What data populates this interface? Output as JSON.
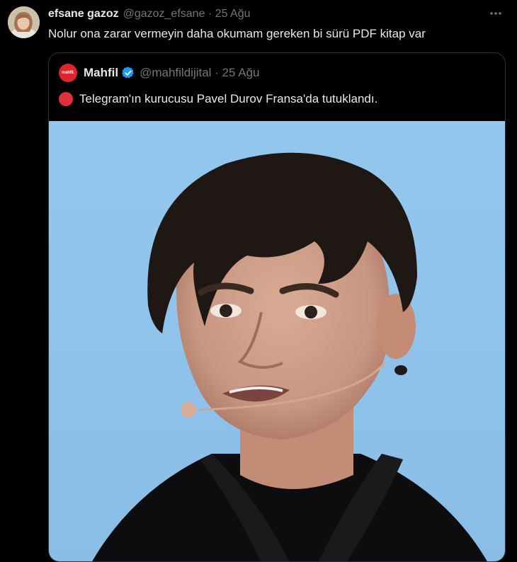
{
  "tweet": {
    "author_name": "efsane gazoz",
    "handle_date": "@gazoz_efsane · 25 Ağu",
    "text": "Nolur ona zarar vermeyin daha okumam gereken bi sürü PDF kitap var",
    "more_icon": "more-horizontal-icon"
  },
  "quoted": {
    "author_name": "Mahfil",
    "avatar_text": "mahfil.",
    "verified_icon": "verified-badge-icon",
    "handle_date": "@mahfildijital · 25 Ağu",
    "text": "Telegram'ın kurucusu Pavel Durov Fransa'da tutuklandı.",
    "emoji": "red-circle-icon"
  },
  "colors": {
    "background": "#000000",
    "text": "#e7e9ea",
    "muted": "#71767b",
    "border": "#2f3336",
    "verified": "#1d9bf0",
    "red": "#e0303a",
    "photo_bg": "#8fc3eb"
  }
}
